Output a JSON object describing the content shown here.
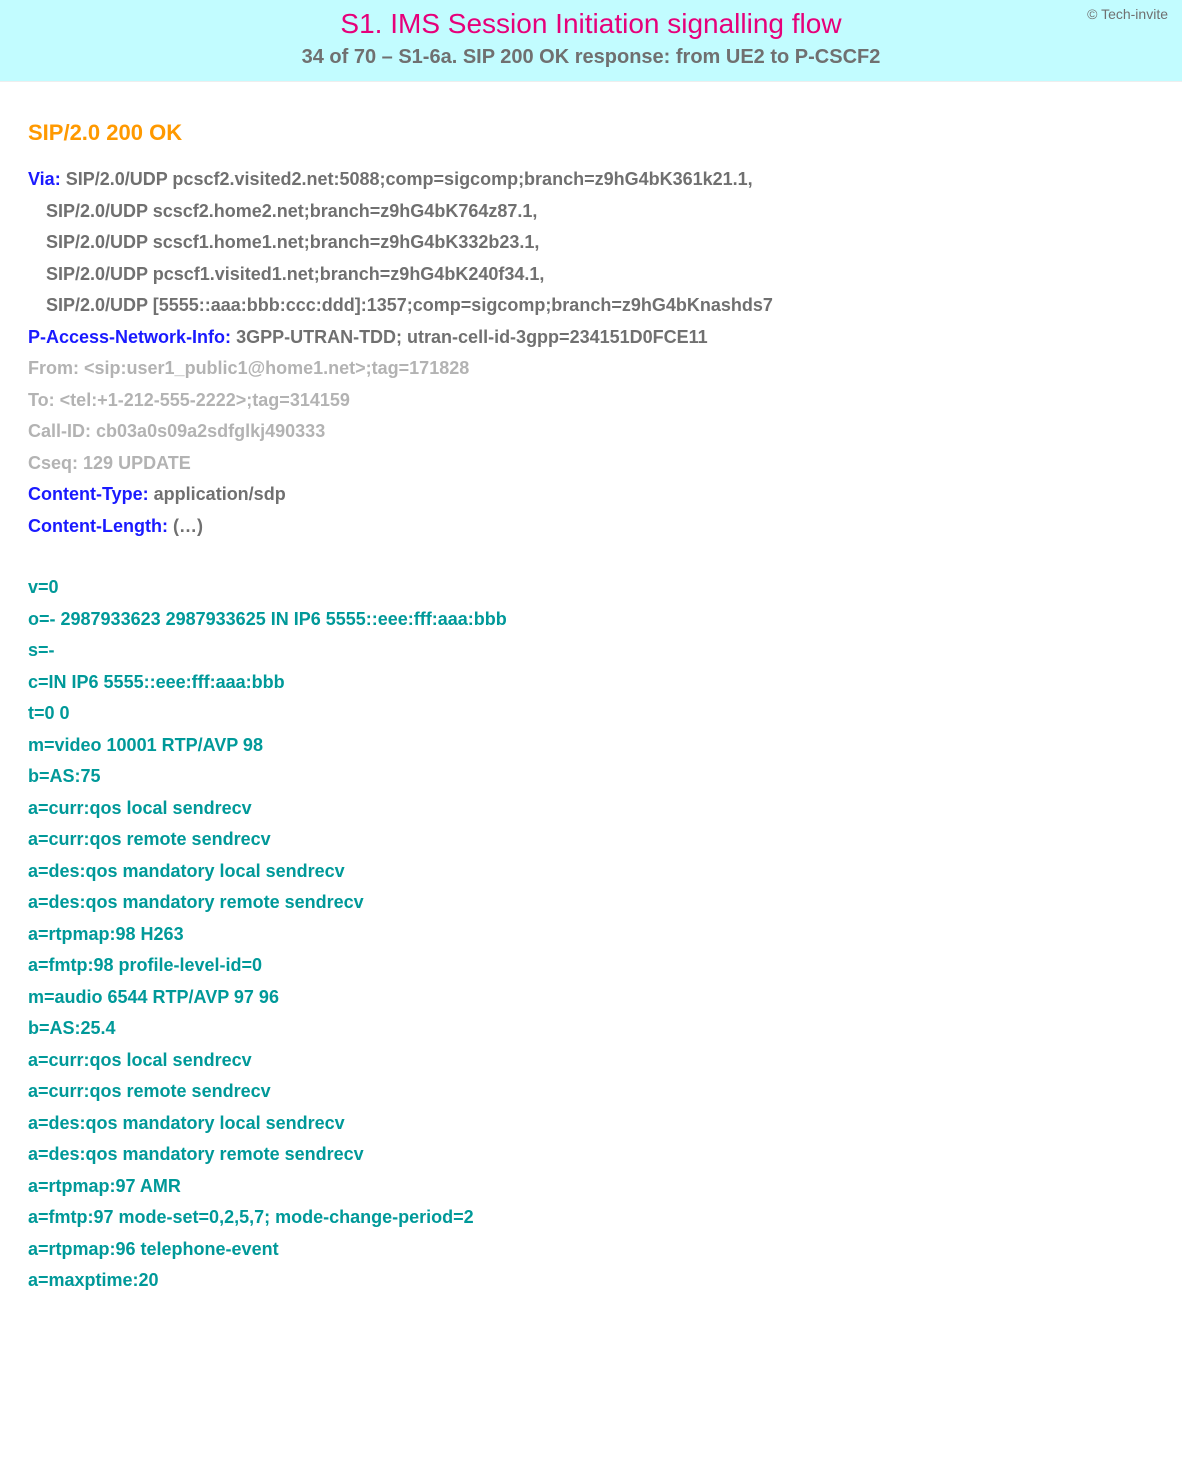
{
  "copyright": "© Tech-invite",
  "title": "S1. IMS Session Initiation signalling flow",
  "subtitle": "34 of 70 – S1-6a. SIP 200 OK response: from UE2 to P-CSCF2",
  "status_line": "SIP/2.0 200 OK",
  "headers": {
    "via": {
      "name": "Via",
      "lines": [
        "SIP/2.0/UDP pcscf2.visited2.net:5088;comp=sigcomp;branch=z9hG4bK361k21.1,",
        "SIP/2.0/UDP scscf2.home2.net;branch=z9hG4bK764z87.1,",
        "SIP/2.0/UDP scscf1.home1.net;branch=z9hG4bK332b23.1,",
        "SIP/2.0/UDP pcscf1.visited1.net;branch=z9hG4bK240f34.1,",
        "SIP/2.0/UDP [5555::aaa:bbb:ccc:ddd]:1357;comp=sigcomp;branch=z9hG4bKnashds7"
      ]
    },
    "pani": {
      "name": "P-Access-Network-Info",
      "value": "3GPP-UTRAN-TDD; utran-cell-id-3gpp=234151D0FCE11"
    },
    "from": {
      "name": "From",
      "value": "<sip:user1_public1@home1.net>;tag=171828"
    },
    "to": {
      "name": "To",
      "value": "<tel:+1-212-555-2222>;tag=314159"
    },
    "callid": {
      "name": "Call-ID",
      "value": "cb03a0s09a2sdfglkj490333"
    },
    "cseq": {
      "name": "Cseq",
      "value": "129 UPDATE"
    },
    "ctype": {
      "name": "Content-Type",
      "value": "application/sdp"
    },
    "clen": {
      "name": "Content-Length",
      "value": "(…)"
    }
  },
  "sdp": [
    "v=0",
    "o=- 2987933623 2987933625 IN IP6 5555::eee:fff:aaa:bbb",
    "s=-",
    "c=IN IP6 5555::eee:fff:aaa:bbb",
    "t=0 0",
    "m=video 10001 RTP/AVP 98",
    "b=AS:75",
    "a=curr:qos local sendrecv",
    "a=curr:qos remote sendrecv",
    "a=des:qos mandatory local sendrecv",
    "a=des:qos mandatory remote sendrecv",
    "a=rtpmap:98 H263",
    "a=fmtp:98 profile-level-id=0",
    "m=audio 6544 RTP/AVP 97 96",
    "b=AS:25.4",
    "a=curr:qos local sendrecv",
    "a=curr:qos remote sendrecv",
    "a=des:qos mandatory local sendrecv",
    "a=des:qos mandatory remote sendrecv",
    "a=rtpmap:97 AMR",
    "a=fmtp:97 mode-set=0,2,5,7; mode-change-period=2",
    "a=rtpmap:96 telephone-event",
    "a=maxptime:20"
  ]
}
